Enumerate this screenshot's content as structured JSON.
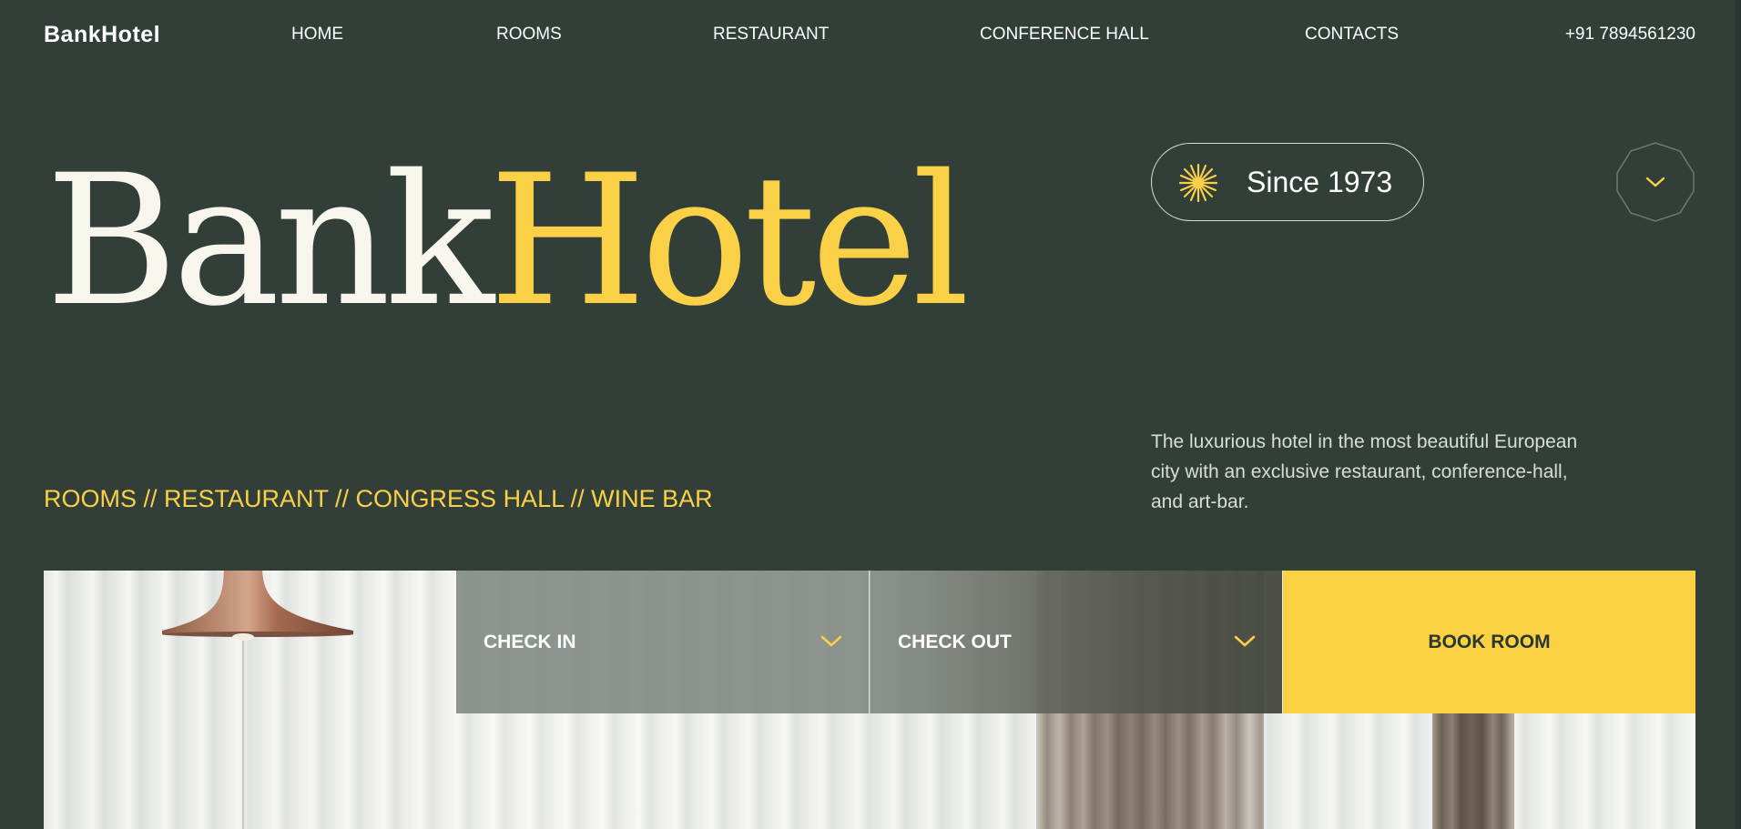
{
  "header": {
    "logo": "BankHotel",
    "nav": [
      {
        "label": "HOME"
      },
      {
        "label": "ROOMS"
      },
      {
        "label": "RESTAURANT"
      },
      {
        "label": "CONFERENCE HALL"
      },
      {
        "label": "CONTACTS"
      }
    ],
    "phone": "+91 7894561230"
  },
  "hero": {
    "title_part1": "Bank",
    "title_part2": "Hotel",
    "since": "Since 1973",
    "tagline": "ROOMS // RESTAURANT // CONGRESS HALL // WINE BAR",
    "description": "The luxurious hotel in the most beautiful European city with an exclusive restaurant, conference-hall, and art-bar."
  },
  "booking": {
    "check_in": "CHECK IN",
    "check_out": "CHECK OUT",
    "book_button": "BOOK ROOM"
  },
  "icons": {
    "star": "sparkle-star-icon",
    "scroll": "chevron-down-icon",
    "field_chevron": "chevron-down-icon"
  },
  "colors": {
    "background": "#323f39",
    "accent": "#f9d046",
    "text": "#ffffff"
  }
}
